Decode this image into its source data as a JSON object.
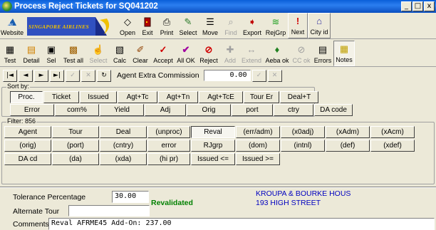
{
  "window": {
    "title": "Process Reject Tickets for SQ041202",
    "min": "_",
    "max": "□",
    "close": "x"
  },
  "toolbar1": [
    {
      "label": "Website",
      "icon": "airline-logo-icon"
    },
    {
      "label": "Open",
      "icon": "open-icon"
    },
    {
      "label": "Exit",
      "icon": "exit-icon"
    },
    {
      "label": "Print",
      "icon": "printer-icon"
    },
    {
      "label": "Select",
      "icon": "select-icon"
    },
    {
      "label": "Move",
      "icon": "move-icon"
    },
    {
      "label": "Find",
      "icon": "find-icon"
    },
    {
      "label": "Export",
      "icon": "export-icon"
    },
    {
      "label": "RejGrp",
      "icon": "reject-group-icon"
    },
    {
      "label": "Next",
      "icon": "next-icon"
    },
    {
      "label": "City id",
      "icon": "city-icon"
    }
  ],
  "banner": {
    "text": "SINGAPORE AIRLINES"
  },
  "toolbar2": [
    {
      "label": "Test",
      "icon": "calculator-icon"
    },
    {
      "label": "Detail",
      "icon": "detail-icon"
    },
    {
      "label": "Sel",
      "icon": "sel-icon"
    },
    {
      "label": "Test all",
      "icon": "test-all-icon"
    },
    {
      "label": "Select",
      "icon": "select-hand-icon"
    },
    {
      "label": "Calc",
      "icon": "calc-icon"
    },
    {
      "label": "Clear",
      "icon": "clear-icon"
    },
    {
      "label": "Accept",
      "icon": "accept-check-icon"
    },
    {
      "label": "All OK",
      "icon": "all-ok-icon"
    },
    {
      "label": "Reject",
      "icon": "reject-icon"
    },
    {
      "label": "Add",
      "icon": "add-icon"
    },
    {
      "label": "Extend",
      "icon": "extend-icon"
    },
    {
      "label": "Aeba ok",
      "icon": "aeba-ok-icon"
    },
    {
      "label": "CC ok",
      "icon": "cc-ok-icon"
    },
    {
      "label": "Errors",
      "icon": "errors-icon"
    },
    {
      "label": "Notes",
      "icon": "notes-icon"
    }
  ],
  "navbar": {
    "first": "|◄",
    "prev": "◄",
    "next": "►",
    "last": "►|",
    "check": "✓",
    "cancel": "✕",
    "refresh": "↻",
    "commission_label": "Agent Extra Commission",
    "commission_value": "0.00"
  },
  "sort": {
    "label": "Sort by:",
    "row1": [
      "Proc.",
      "Ticket",
      "Issued",
      "Agt+Tc",
      "Agt+Tn",
      "Agt+TcE",
      "Tour Er",
      "Deal+T"
    ],
    "row2": [
      "Error",
      "com%",
      "Yield",
      "Adj",
      "Orig",
      "port",
      "ctry",
      "DA code"
    ]
  },
  "filter": {
    "label": "Filter: 856",
    "row1": [
      "Agent",
      "Tour",
      "Deal",
      "(unproc)",
      "Reval",
      "(err/adm)",
      "(x0adj)",
      "(xAdm)",
      "(xAcm)"
    ],
    "row2": [
      "(orig)",
      "(port)",
      "(cntry)",
      "error",
      "RJgrp",
      "(dom)",
      "(intnl)",
      "(def)",
      "(xdef)"
    ],
    "row3": [
      "DA cd",
      "(da)",
      "(xda)",
      "(hi pr)",
      "Issued <=",
      "Issued >="
    ]
  },
  "bottom": {
    "tolerance_label": "Tolerance Percentage",
    "tolerance_value": "30.00",
    "status": "Revalidated",
    "address1": "KROUPA & BOURKE HOUS",
    "address2": "193 HIGH STREET",
    "alt_tour_label": "Alternate Tour",
    "alt_tour_value": "",
    "comments_label": "Comments",
    "comments_value": "Reval AFRME45 Add-On:   237.00"
  },
  "colors": {
    "title_bar": "#0a5fd8",
    "status_green": "#008000",
    "address_blue": "#0000c0"
  }
}
